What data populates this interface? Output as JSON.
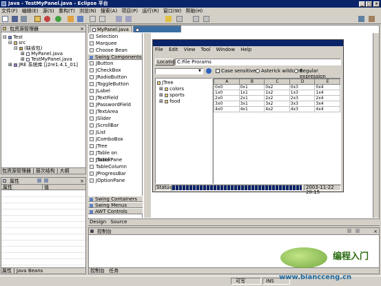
{
  "window": {
    "title": "Java - TestMyPanel.java - Eclipse 平台"
  },
  "menu": [
    "文件(F)",
    "编辑(E)",
    "源(S)",
    "重构(T)",
    "浏览(N)",
    "搜索(A)",
    "项目(P)",
    "运行(R)",
    "窗口(W)",
    "帮助(H)"
  ],
  "package_explorer": {
    "title": "包资源管理器",
    "tree": [
      "Test",
      "src",
      "(缺省包)",
      "MyPanel.java",
      "TestMyPanel.java",
      "JRE 系统库 [j2re1.4.1_01]"
    ],
    "bottom_tabs": [
      "包资源管理器",
      "层次结构",
      "大纲"
    ]
  },
  "properties": {
    "title": "属性",
    "columns": [
      "属性",
      "值"
    ],
    "bottom_tabs": [
      "属性",
      "Java Beans"
    ]
  },
  "palette": {
    "top_items": [
      "Selection",
      "Marquee",
      "Choose Bean"
    ],
    "swing_header": "Swing Components",
    "swing_items": [
      "JButton",
      "JCheckBox",
      "JRadioButton",
      "JToggleButton",
      "JLabel",
      "JTextField",
      "JPasswordField",
      "JTextArea",
      "JSlider",
      "JScrollBar",
      "JList",
      "JComboBox",
      "JTree",
      "JTable on JScrollPane",
      "JTable",
      "TableColumn",
      "JProgressBar",
      "JOptionPane"
    ],
    "group_headers": [
      "Swing Containers",
      "Swing Menus",
      "AWT Controls"
    ]
  },
  "editor": {
    "tabs": [
      "MyPanel.java",
      "*TestMyPanel.java"
    ],
    "bottom_tabs": [
      "Design",
      "Source"
    ]
  },
  "app": {
    "menu": [
      "File",
      "Edit",
      "View",
      "Tool",
      "Window",
      "Help"
    ],
    "location_label": "Location",
    "location_value": "C:File Prorams",
    "options": [
      "Case sensitive",
      "Asterick wildcard",
      "Regular expression"
    ],
    "tree_root": "JTree",
    "tree_children": [
      "colors",
      "sports",
      "food"
    ],
    "table_headers": [
      "A",
      "B",
      "C",
      "D",
      "E"
    ],
    "table_rows": [
      [
        "0x0",
        "0x1",
        "0x2",
        "0x3",
        "0x4"
      ],
      [
        "1x0",
        "1x1",
        "1x2",
        "1x3",
        "1x4"
      ],
      [
        "2x0",
        "2x1",
        "2x2",
        "2x3",
        "2x4"
      ],
      [
        "3x0",
        "3x1",
        "3x2",
        "3x3",
        "3x4"
      ],
      [
        "4x0",
        "4x1",
        "4x2",
        "4x3",
        "4x4"
      ]
    ],
    "status_label": "Status",
    "status_time": "2003-11-22 20:15"
  },
  "console": {
    "title": "控制台",
    "bottom_tabs": [
      "控制台",
      "任务"
    ]
  },
  "statusbar": {
    "writable": "可写",
    "insert": "INS"
  },
  "watermark": {
    "text": "编程入门",
    "url": "www.biancceng.cn"
  },
  "colors": {
    "titlebar": "#0a246a",
    "progress": "#0a246a",
    "accent": "#3a6ea5"
  }
}
